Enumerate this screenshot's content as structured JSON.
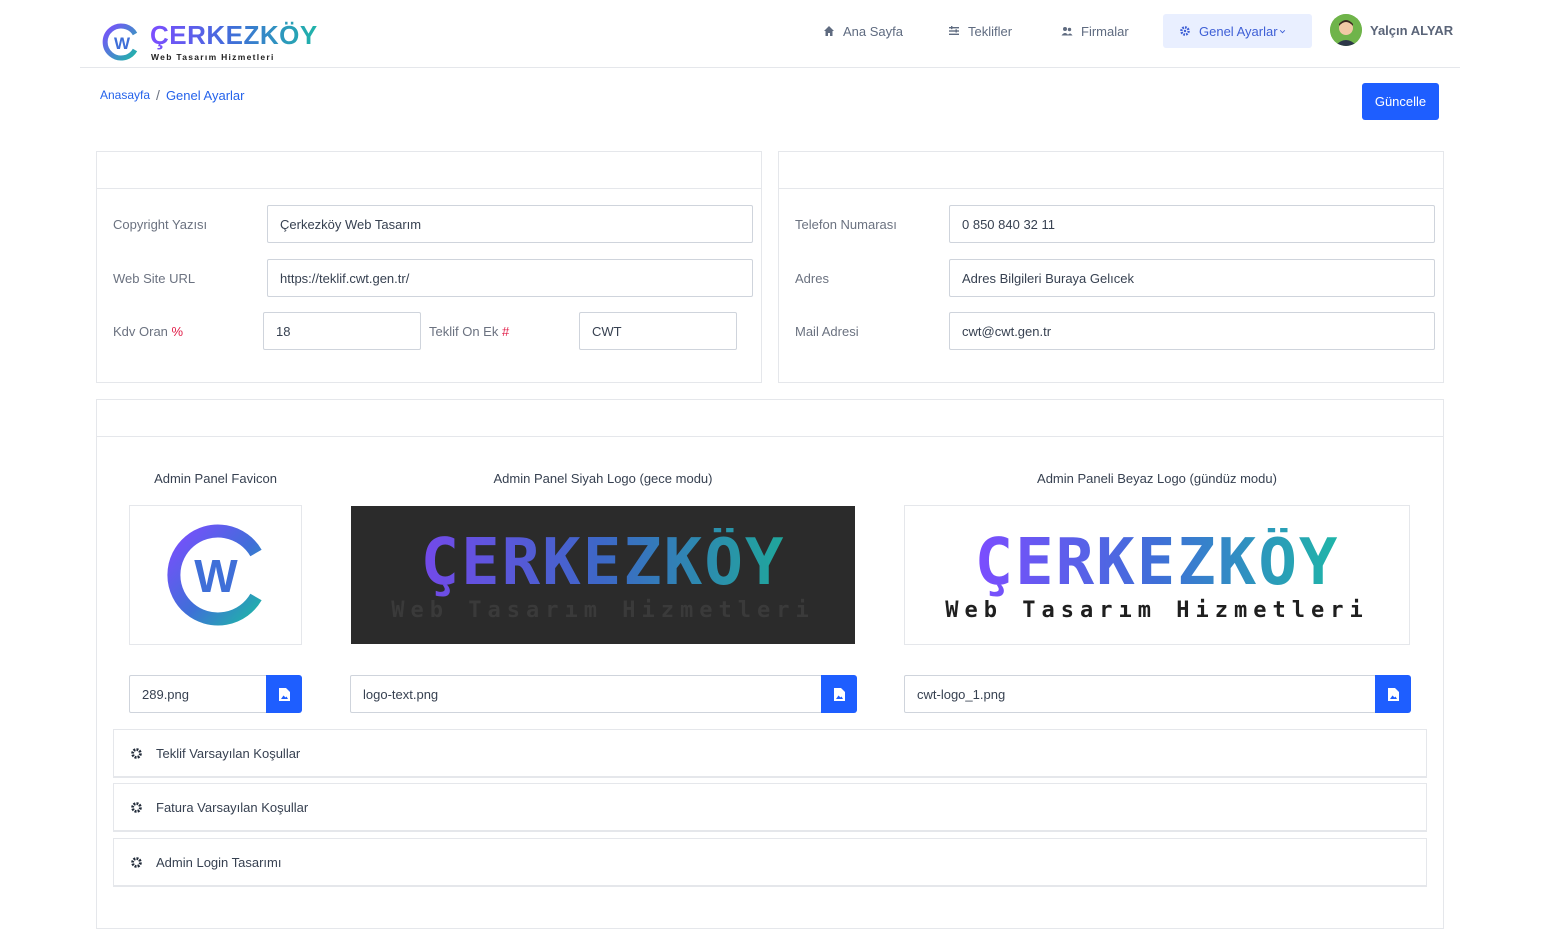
{
  "brand": {
    "name": "ÇERKEZKÖY",
    "subtitle": "Web Tasarım Hizmetleri",
    "mark_letter": "W"
  },
  "nav": {
    "items": [
      {
        "label": "Ana Sayfa",
        "icon": "home-icon"
      },
      {
        "label": "Teklifler",
        "icon": "list-icon"
      },
      {
        "label": "Firmalar",
        "icon": "users-icon"
      },
      {
        "label": "Genel Ayarlar",
        "icon": "gear-icon",
        "active": true
      }
    ],
    "user": {
      "name": "Yalçın ALYAR"
    }
  },
  "breadcrumb": {
    "home": "Anasayfa",
    "separator": "/",
    "current": "Genel Ayarlar"
  },
  "actions": {
    "update_label": "Güncelle"
  },
  "general": {
    "copyright_label": "Copyright Yazısı",
    "copyright_value": "Çerkezköy Web Tasarım",
    "url_label": "Web Site URL",
    "url_value": "https://teklif.cwt.gen.tr/",
    "kdv_label": "Kdv Oran",
    "kdv_symbol": "%",
    "kdv_value": "18",
    "prefix_label": "Teklif On Ek",
    "prefix_symbol": "#",
    "prefix_value": "CWT"
  },
  "contact": {
    "phone_label": "Telefon Numarası",
    "phone_value": "0 850 840 32 11",
    "address_label": "Adres",
    "address_value": "Adres Bilgileri Buraya Gelıcek",
    "mail_label": "Mail Adresi",
    "mail_value": "cwt@cwt.gen.tr"
  },
  "logos": {
    "favicon_title": "Admin Panel Favicon",
    "favicon_file": "289.png",
    "dark_title": "Admin Panel Siyah Logo (gece modu)",
    "dark_file": "logo-text.png",
    "dark_logo_text": "ÇERKEZKÖY",
    "dark_logo_sub": "Web Tasarım Hizmetleri",
    "light_title": "Admin Paneli Beyaz Logo (gündüz modu)",
    "light_file": "cwt-logo_1.png",
    "light_logo_text": "ÇERKEZKÖY",
    "light_logo_sub": "Web Tasarım Hizmetleri"
  },
  "accordions": [
    {
      "label": "Teklif Varsayılan Koşullar"
    },
    {
      "label": "Fatura Varsayılan Koşullar"
    },
    {
      "label": "Admin Login Tasarımı"
    }
  ],
  "colors": {
    "primary": "#1e5eff",
    "accent": "#e11d48",
    "brand_from": "#7c4dff",
    "brand_to": "#1fb5a8"
  }
}
